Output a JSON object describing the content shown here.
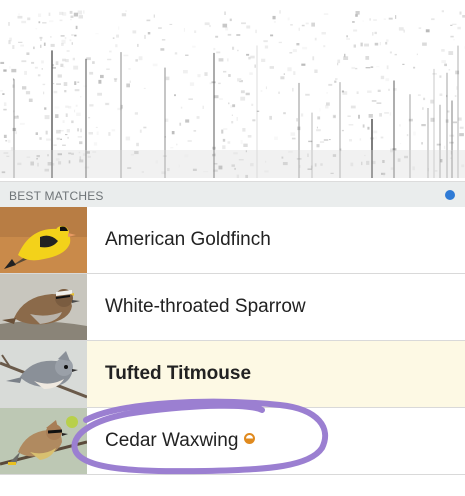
{
  "section_header": {
    "label": "BEST MATCHES"
  },
  "status_dot_color": "#2f7bd6",
  "highlight_color": "#fdf9e4",
  "annotation_color": "#9b7fd1",
  "matches": [
    {
      "name": "American Goldfinch",
      "icon": "american-goldfinch-photo",
      "highlighted": false,
      "rare": false
    },
    {
      "name": "White-throated Sparrow",
      "icon": "white-throated-sparrow-photo",
      "highlighted": false,
      "rare": false
    },
    {
      "name": "Tufted Titmouse",
      "icon": "tufted-titmouse-photo",
      "highlighted": true,
      "rare": false
    },
    {
      "name": "Cedar Waxwing",
      "icon": "cedar-waxwing-photo",
      "highlighted": false,
      "rare": true,
      "rare_color": "#e08a1e"
    }
  ]
}
